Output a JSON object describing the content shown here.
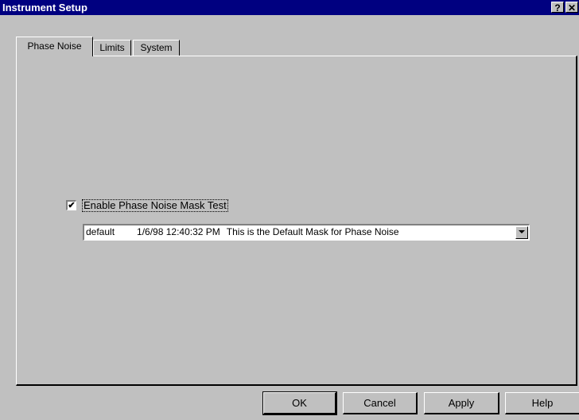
{
  "window": {
    "title": "Instrument Setup",
    "help_button": "?",
    "close_button": "✕"
  },
  "tabs": [
    {
      "label": "Phase Noise",
      "active": true
    },
    {
      "label": "Limits",
      "active": false
    },
    {
      "label": "System",
      "active": false
    }
  ],
  "phase_noise": {
    "enable_mask_label": "Enable Phase Noise Mask Test",
    "enable_mask_checked": true,
    "check_glyph": "✔",
    "mask_select": {
      "name": "default",
      "date": "1/6/98 12:40:32 PM",
      "description": "This is the Default Mask for Phase Noise"
    }
  },
  "buttons": {
    "ok": "OK",
    "cancel": "Cancel",
    "apply": "Apply",
    "help": "Help"
  }
}
